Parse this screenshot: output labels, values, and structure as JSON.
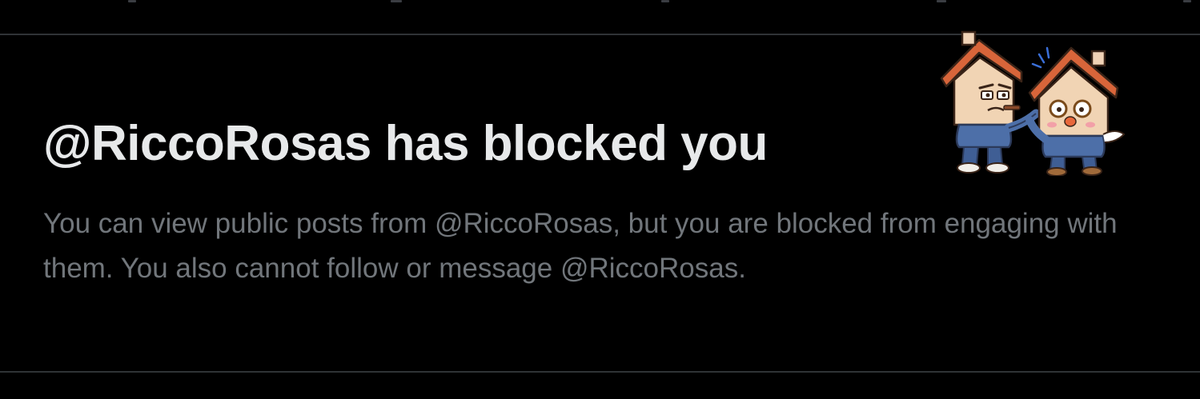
{
  "blocked_notice": {
    "title": "@RiccoRosas has blocked you",
    "description": "You can view public posts from @RiccoRosas, but you are blocked from engaging with them. You also cannot follow or message @RiccoRosas."
  },
  "sticker": {
    "icon": "house-mascots-sticker-icon"
  },
  "colors": {
    "background": "#000000",
    "title": "#e7e9ea",
    "description": "#71767b",
    "divider": "#2f3336"
  }
}
